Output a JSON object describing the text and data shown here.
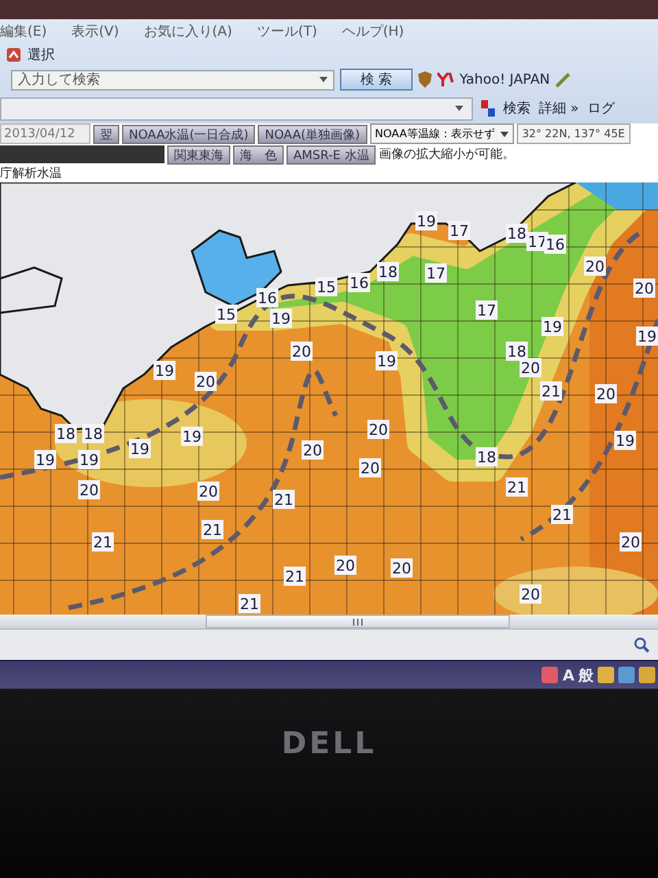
{
  "menu": [
    "編集(E)",
    "表示(V)",
    "お気に入り(A)",
    "ツール(T)",
    "ヘルプ(H)"
  ],
  "toolbar": {
    "select_label": "選択"
  },
  "search_bar": {
    "placeholder": "入力して検索",
    "button": "検 索",
    "provider": "Yahoo! JAPAN"
  },
  "links_bar": {
    "search": "検索",
    "details": "詳細 »",
    "cut": "ログ"
  },
  "controls": {
    "date": "2013/04/12",
    "step_button": "翌",
    "buttons_row1": [
      "NOAA水温(一日合成)",
      "NOAA(単独画像)"
    ],
    "isotherm_select": "NOAA等温線：表示せず",
    "coords": "32° 22N,  137° 45E",
    "buttons_row2": [
      "関東東海",
      "海　色",
      "AMSR-E 水温"
    ],
    "hint": "画像の拡大縮小が可能。"
  },
  "map": {
    "caption": "庁解析水温",
    "labels": [
      "19",
      "17",
      "18",
      "17",
      "16",
      "20",
      "20",
      "15",
      "16",
      "15",
      "16",
      "18",
      "17",
      "19",
      "17",
      "19",
      "20",
      "19",
      "18",
      "20",
      "21",
      "20",
      "19",
      "19",
      "20",
      "18",
      "18",
      "19",
      "19",
      "19",
      "19",
      "20",
      "20",
      "21",
      "21",
      "21",
      "20",
      "20",
      "20",
      "18",
      "21",
      "21",
      "19",
      "20",
      "21",
      "20",
      "20",
      "21",
      "20"
    ]
  },
  "taskbar": {
    "ime": [
      "A",
      "般"
    ]
  },
  "bezel": {
    "logo": "DELL"
  }
}
